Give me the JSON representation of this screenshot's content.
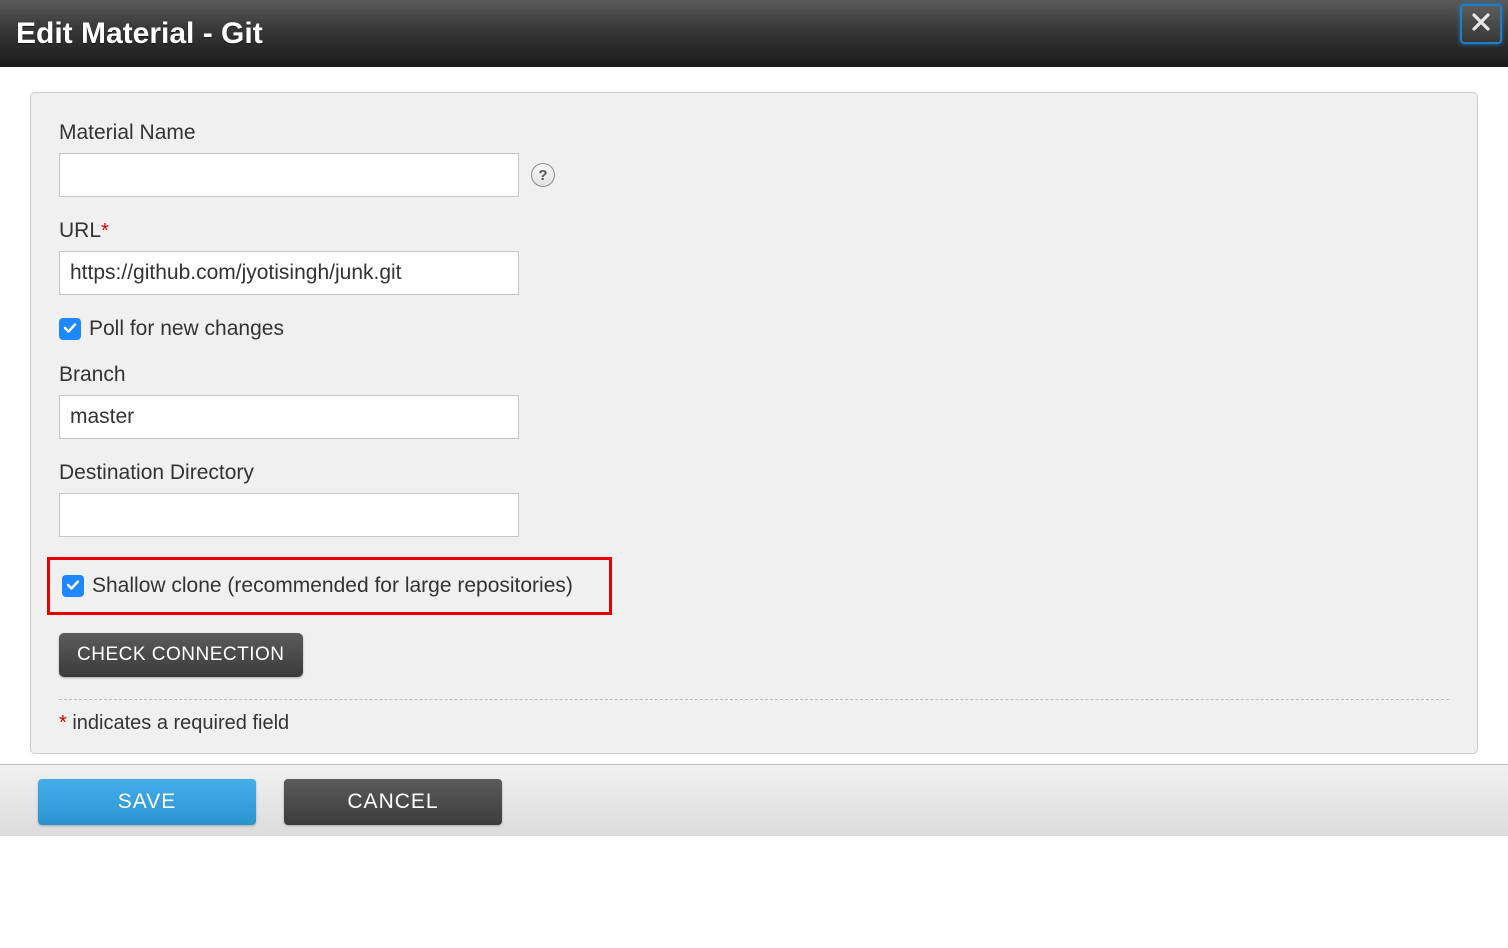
{
  "header": {
    "title": "Edit Material - Git"
  },
  "form": {
    "material_name": {
      "label": "Material Name",
      "value": ""
    },
    "url": {
      "label": "URL",
      "value": "https://github.com/jyotisingh/junk.git",
      "required": true
    },
    "poll": {
      "label": "Poll for new changes",
      "checked": true
    },
    "branch": {
      "label": "Branch",
      "value": "master"
    },
    "destination": {
      "label": "Destination Directory",
      "value": ""
    },
    "shallow_clone": {
      "label": "Shallow clone (recommended for large repositories)",
      "checked": true
    },
    "check_connection_label": "CHECK CONNECTION",
    "required_note_prefix": "*",
    "required_note_text": " indicates a required field"
  },
  "footer": {
    "save_label": "SAVE",
    "cancel_label": "CANCEL"
  }
}
